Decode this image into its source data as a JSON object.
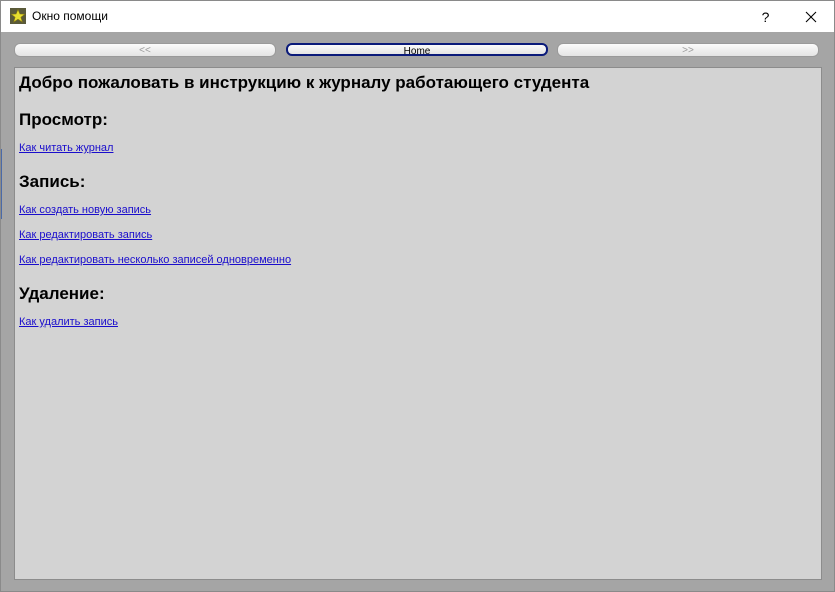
{
  "window": {
    "title": "Окно помощи",
    "help_label": "?",
    "close_label": "✕"
  },
  "nav": {
    "back_label": "<<",
    "home_label": "Home",
    "forward_label": ">>"
  },
  "content": {
    "heading": "Добро пожаловать в инструкцию к журналу работающего студента",
    "sections": [
      {
        "title": "Просмотр:",
        "links": [
          "Как читать журнал"
        ]
      },
      {
        "title": "Запись:",
        "links": [
          "Как создать новую запись",
          "Как редактировать запись",
          "Как редактировать несколько записей одновременно"
        ]
      },
      {
        "title": "Удаление:",
        "links": [
          "Как удалить запись"
        ]
      }
    ]
  },
  "colors": {
    "link": "#1a0dcc",
    "content_bg": "#d3d3d3",
    "window_bg": "#a5a5a5",
    "home_border": "#0a1a7a"
  }
}
